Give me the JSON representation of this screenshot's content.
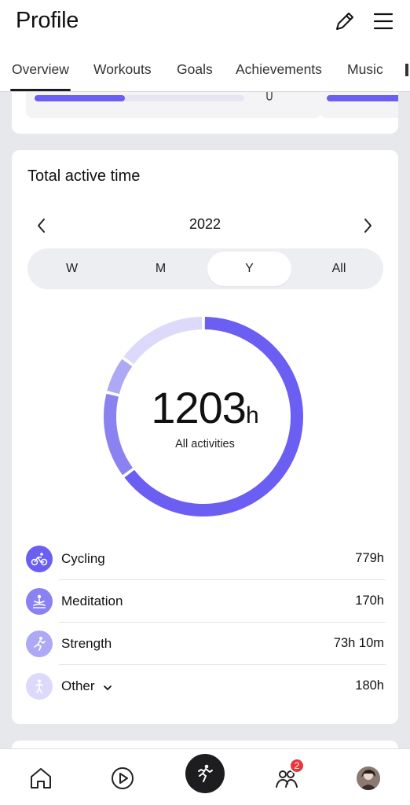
{
  "header": {
    "title": "Profile",
    "edit_icon": "pencil-icon",
    "menu_icon": "hamburger-menu-icon"
  },
  "tabs": [
    {
      "label": "Overview",
      "active": true
    },
    {
      "label": "Workouts",
      "active": false
    },
    {
      "label": "Goals",
      "active": false
    },
    {
      "label": "Achievements",
      "active": false
    },
    {
      "label": "Music",
      "active": false
    }
  ],
  "previous_card": {
    "progress_fraction": 0.43
  },
  "active_time": {
    "title": "Total active time",
    "period_label": "2022",
    "periods": [
      {
        "label": "W",
        "active": false
      },
      {
        "label": "M",
        "active": false
      },
      {
        "label": "Y",
        "active": true
      },
      {
        "label": "All",
        "active": false
      }
    ],
    "total_value": "1203",
    "total_unit": "h",
    "total_caption": "All activities",
    "activities": [
      {
        "label": "Cycling",
        "value": "779h",
        "hours": 779,
        "color": "#6b5ef2",
        "icon": "cycling-icon"
      },
      {
        "label": "Meditation",
        "value": "170h",
        "hours": 170,
        "color": "#8b82f2",
        "icon": "meditation-icon"
      },
      {
        "label": "Strength",
        "value": "73h 10m",
        "hours": 73.17,
        "color": "#aea9f4",
        "icon": "strength-icon"
      },
      {
        "label": "Other",
        "value": "180h",
        "hours": 180,
        "color": "#dcd9fb",
        "icon": "other-activity-icon"
      }
    ]
  },
  "bottom_nav": {
    "items": [
      "home-icon",
      "play-icon",
      "workout-run-icon",
      "friends-icon",
      "profile-avatar"
    ],
    "notification_count": "2"
  },
  "colors": {
    "accent": "#6b5ef2",
    "background": "#e7e8ec"
  }
}
